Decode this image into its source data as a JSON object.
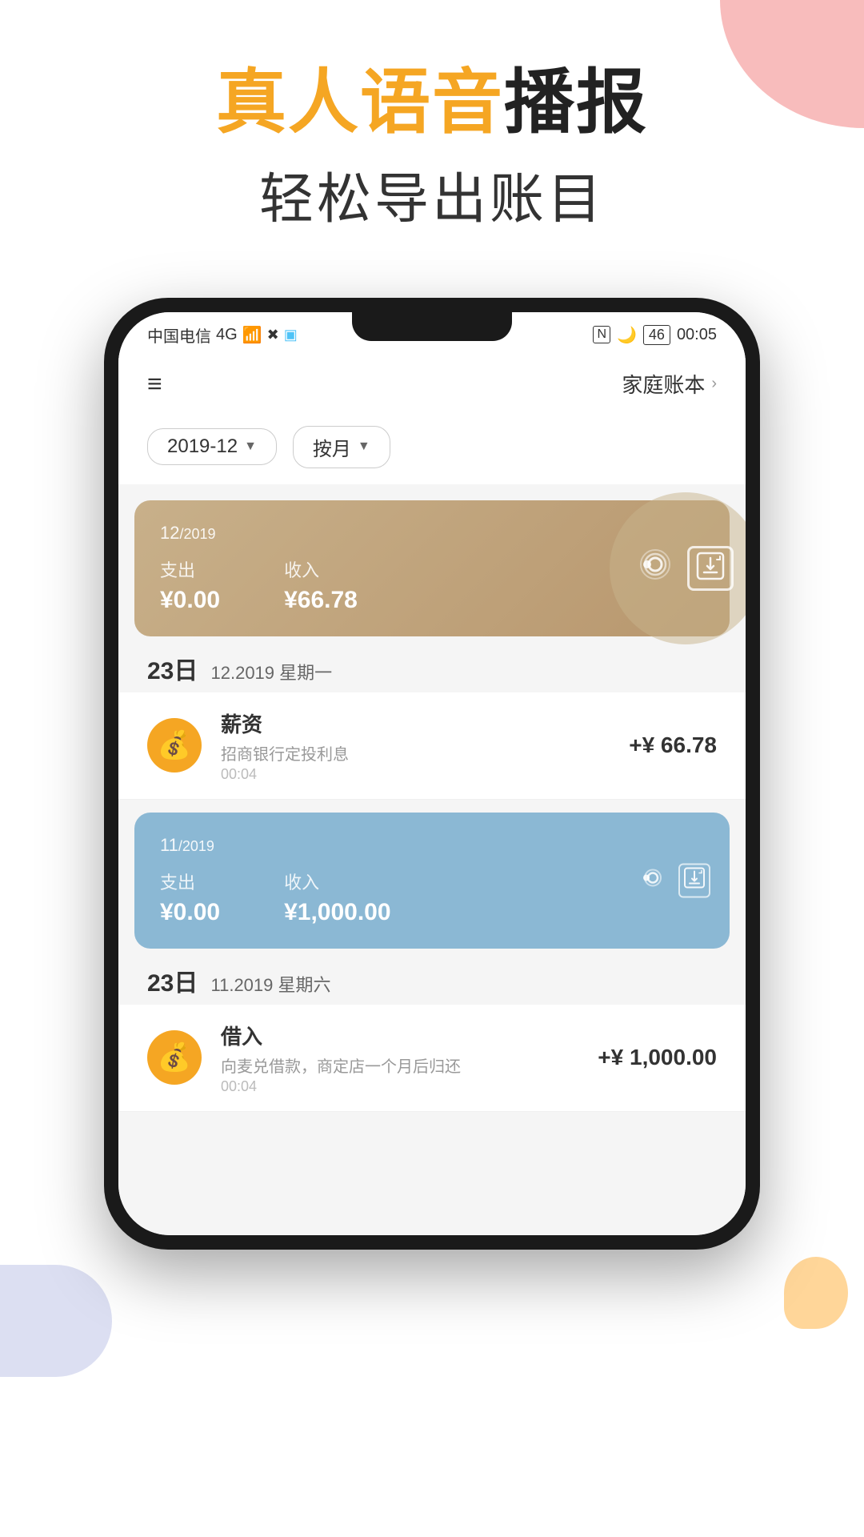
{
  "decorations": {
    "topRight": "deco-top-right",
    "bottomLeft": "deco-bottom-left",
    "bottomRight": "deco-bottom-right"
  },
  "header": {
    "line1_orange": "真人语音",
    "line1_black": "播报",
    "line2": "轻松导出账目"
  },
  "statusBar": {
    "carrier": "中国电信",
    "signal": "4G",
    "time": "00:05",
    "battery": "46"
  },
  "appTopBar": {
    "accountName": "家庭账本",
    "menuIcon": "≡"
  },
  "filters": {
    "dateFilter": "2019-12",
    "periodFilter": "按月"
  },
  "decCard": {
    "monthYear": "12",
    "yearSuffix": "/2019",
    "expendLabel": "支出",
    "expendValue": "¥0.00",
    "incomeLabel": "收入",
    "incomeValue": "¥66.78"
  },
  "decDay": {
    "dayNum": "23日",
    "dateDetail": "12.2019 星期一"
  },
  "decTransaction": {
    "category": "薪资",
    "description": "招商银行定投利息",
    "time": "00:04",
    "amount": "+¥ 66.78"
  },
  "novCard": {
    "monthYear": "11",
    "yearSuffix": "/2019",
    "expendLabel": "支出",
    "expendValue": "¥0.00",
    "incomeLabel": "收入",
    "incomeValue": "¥1,000.00"
  },
  "novDay": {
    "dayNum": "23日",
    "dateDetail": "11.2019 星期六"
  },
  "novTransaction": {
    "category": "借入",
    "description": "向麦兑借款，商定店一个月后归还",
    "time": "00:04",
    "amount": "+¥ 1,000.00"
  },
  "colors": {
    "orange": "#f5a623",
    "decCardBg1": "#c8b08a",
    "decCardBg2": "#b8976e",
    "novCardBg": "#8bb8d4",
    "iconBg": "#f5a623"
  }
}
